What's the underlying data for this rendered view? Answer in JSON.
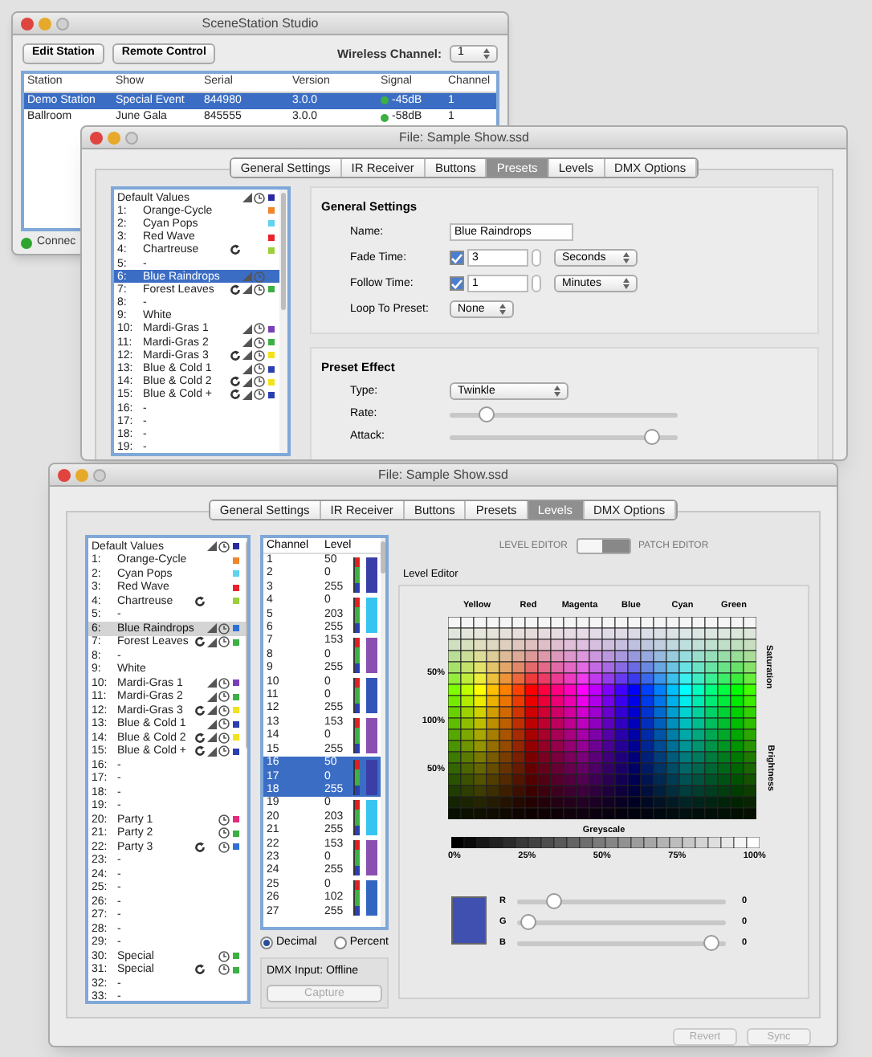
{
  "station_window": {
    "title": "SceneStation Studio",
    "buttons": [
      "Edit Station",
      "Remote Control"
    ],
    "wireless_channel": {
      "label": "Wireless Channel:",
      "value": "1"
    },
    "table": {
      "columns": [
        "Station",
        "Show",
        "Serial",
        "Version",
        "Signal",
        "Channel"
      ],
      "rows": [
        {
          "cells": [
            "Demo Station",
            "Special Event",
            "844980",
            "3.0.0",
            "-45dB",
            "1"
          ],
          "selected": true
        },
        {
          "cells": [
            "Ballroom",
            "June Gala",
            "845555",
            "3.0.0",
            "-58dB",
            "1"
          ],
          "selected": false
        }
      ]
    },
    "status": {
      "text": "Connec",
      "color": "#2fa52f"
    }
  },
  "presets_window": {
    "title": "File: Sample Show.ssd",
    "tabs": [
      {
        "label": "General Settings",
        "selected": false
      },
      {
        "label": "IR Receiver",
        "selected": false
      },
      {
        "label": "Buttons",
        "selected": false
      },
      {
        "label": "Presets",
        "selected": true
      },
      {
        "label": "Levels",
        "selected": false
      },
      {
        "label": "DMX Options",
        "selected": false
      }
    ],
    "presets": [
      {
        "name": "Default Values",
        "loop": false,
        "fade": true,
        "clock": true,
        "color": "#2a2aa0",
        "selected": false
      },
      {
        "number": "1:",
        "name": "Orange-Cycle",
        "loop": false,
        "fade": false,
        "clock": false,
        "color": "#f0852a",
        "selected": false
      },
      {
        "number": "2:",
        "name": "Cyan Pops",
        "loop": false,
        "fade": false,
        "clock": false,
        "color": "#5fd3ef",
        "selected": false
      },
      {
        "number": "3:",
        "name": "Red Wave",
        "loop": false,
        "fade": false,
        "clock": false,
        "color": "#e8242a",
        "selected": false
      },
      {
        "number": "4:",
        "name": "Chartreuse",
        "loop": true,
        "fade": false,
        "clock": false,
        "color": "#9ccf3a",
        "selected": false
      },
      {
        "number": "5:",
        "name": "-",
        "loop": false,
        "fade": false,
        "clock": false,
        "selected": false
      },
      {
        "number": "6:",
        "name": "Blue Raindrops",
        "loop": false,
        "fade": true,
        "clock": true,
        "selected": true
      },
      {
        "number": "7:",
        "name": "Forest Leaves",
        "loop": true,
        "fade": true,
        "clock": true,
        "color": "#3cb043",
        "selected": false
      },
      {
        "number": "8:",
        "name": "-",
        "loop": false,
        "fade": false,
        "clock": false,
        "selected": false
      },
      {
        "number": "9:",
        "name": "White",
        "loop": false,
        "fade": false,
        "clock": false,
        "selected": false
      },
      {
        "number": "10:",
        "name": "Mardi-Gras 1",
        "loop": false,
        "fade": true,
        "clock": true,
        "color": "#7a3fb8",
        "selected": false
      },
      {
        "number": "11:",
        "name": "Mardi-Gras 2",
        "loop": false,
        "fade": true,
        "clock": true,
        "color": "#3cb043",
        "selected": false
      },
      {
        "number": "12:",
        "name": "Mardi-Gras 3",
        "loop": true,
        "fade": true,
        "clock": true,
        "color": "#f2e21a",
        "selected": false
      },
      {
        "number": "13:",
        "name": "Blue & Cold 1",
        "loop": false,
        "fade": true,
        "clock": true,
        "color": "#2a3fb0",
        "selected": false
      },
      {
        "number": "14:",
        "name": "Blue & Cold 2",
        "loop": true,
        "fade": true,
        "clock": true,
        "color": "#f2e21a",
        "selected": false
      },
      {
        "number": "15:",
        "name": "Blue & Cold +",
        "loop": true,
        "fade": true,
        "clock": true,
        "color": "#2a3fb0",
        "selected": false
      },
      {
        "number": "16:",
        "name": "-",
        "loop": false,
        "fade": false,
        "clock": false,
        "selected": false
      },
      {
        "number": "17:",
        "name": "-",
        "loop": false,
        "fade": false,
        "clock": false,
        "selected": false
      },
      {
        "number": "18:",
        "name": "-",
        "loop": false,
        "fade": false,
        "clock": false,
        "selected": false
      },
      {
        "number": "19:",
        "name": "-",
        "loop": false,
        "fade": false,
        "clock": false,
        "selected": false
      }
    ],
    "general_settings": {
      "title": "General Settings",
      "name": {
        "label": "Name:",
        "value": "Blue Raindrops"
      },
      "times": [
        {
          "label": "Fade Time:",
          "checked": true,
          "value": "3",
          "unit": "Seconds"
        },
        {
          "label": "Follow Time:",
          "checked": true,
          "value": "1",
          "unit": "Minutes"
        }
      ],
      "loop_to_preset": {
        "label": "Loop To Preset:",
        "value": "None"
      }
    },
    "preset_effect": {
      "title": "Preset Effect",
      "type": {
        "label": "Type:",
        "value": "Twinkle"
      },
      "sliders": [
        {
          "label": "Rate:",
          "level": 0.14
        },
        {
          "label": "Attack:",
          "level": 0.92
        }
      ]
    }
  },
  "levels_window": {
    "title": "File: Sample Show.ssd",
    "tabs": [
      {
        "label": "General Settings",
        "selected": false
      },
      {
        "label": "IR Receiver",
        "selected": false
      },
      {
        "label": "Buttons",
        "selected": false
      },
      {
        "label": "Presets",
        "selected": false
      },
      {
        "label": "Levels",
        "selected": true
      },
      {
        "label": "DMX Options",
        "selected": false
      }
    ],
    "presets": [
      {
        "name": "Default Values",
        "loop": false,
        "fade": true,
        "clock": true,
        "color": "#2a2aa0",
        "selected": false
      },
      {
        "number": "1:",
        "name": "Orange-Cycle",
        "loop": false,
        "fade": false,
        "clock": false,
        "color": "#f0852a",
        "selected": false
      },
      {
        "number": "2:",
        "name": "Cyan Pops",
        "loop": false,
        "fade": false,
        "clock": false,
        "color": "#5fd3ef",
        "selected": false
      },
      {
        "number": "3:",
        "name": "Red Wave",
        "loop": false,
        "fade": false,
        "clock": false,
        "color": "#e8242a",
        "selected": false
      },
      {
        "number": "4:",
        "name": "Chartreuse",
        "loop": true,
        "fade": false,
        "clock": false,
        "color": "#9ccf3a",
        "selected": false
      },
      {
        "number": "5:",
        "name": "-",
        "loop": false,
        "fade": false,
        "clock": false,
        "selected": false
      },
      {
        "number": "6:",
        "name": "Blue Raindrops",
        "loop": false,
        "fade": true,
        "clock": true,
        "color": "#2f6fd8",
        "selected": true
      },
      {
        "number": "7:",
        "name": "Forest Leaves",
        "loop": true,
        "fade": true,
        "clock": true,
        "color": "#3cb043",
        "selected": false
      },
      {
        "number": "8:",
        "name": "-",
        "loop": false,
        "fade": false,
        "clock": false,
        "selected": false
      },
      {
        "number": "9:",
        "name": "White",
        "loop": false,
        "fade": false,
        "clock": false,
        "selected": false
      },
      {
        "number": "10:",
        "name": "Mardi-Gras 1",
        "loop": false,
        "fade": true,
        "clock": true,
        "color": "#7a3fb8",
        "selected": false
      },
      {
        "number": "11:",
        "name": "Mardi-Gras 2",
        "loop": false,
        "fade": true,
        "clock": true,
        "color": "#3cb043",
        "selected": false
      },
      {
        "number": "12:",
        "name": "Mardi-Gras 3",
        "loop": true,
        "fade": true,
        "clock": true,
        "color": "#f2e21a",
        "selected": false
      },
      {
        "number": "13:",
        "name": "Blue & Cold 1",
        "loop": false,
        "fade": true,
        "clock": true,
        "color": "#2a3fb0",
        "selected": false
      },
      {
        "number": "14:",
        "name": "Blue & Cold 2",
        "loop": true,
        "fade": true,
        "clock": true,
        "color": "#f2e21a",
        "selected": false
      },
      {
        "number": "15:",
        "name": "Blue & Cold +",
        "loop": true,
        "fade": true,
        "clock": true,
        "color": "#2a3fb0",
        "selected": false
      },
      {
        "number": "16:",
        "name": "-",
        "loop": false,
        "fade": false,
        "clock": false,
        "selected": false
      },
      {
        "number": "17:",
        "name": "-",
        "loop": false,
        "fade": false,
        "clock": false,
        "selected": false
      },
      {
        "number": "18:",
        "name": "-",
        "loop": false,
        "fade": false,
        "clock": false,
        "selected": false
      },
      {
        "number": "19:",
        "name": "-",
        "loop": false,
        "fade": false,
        "clock": false,
        "selected": false
      },
      {
        "number": "20:",
        "name": "Party 1",
        "loop": false,
        "fade": false,
        "clock": true,
        "color": "#e8287a",
        "selected": false
      },
      {
        "number": "21:",
        "name": "Party 2",
        "loop": false,
        "fade": false,
        "clock": true,
        "color": "#3cb043",
        "selected": false
      },
      {
        "number": "22:",
        "name": "Party 3",
        "loop": true,
        "fade": false,
        "clock": true,
        "color": "#2f6fd8",
        "selected": false
      },
      {
        "number": "23:",
        "name": "-",
        "loop": false,
        "fade": false,
        "clock": false,
        "selected": false
      },
      {
        "number": "24:",
        "name": "-",
        "loop": false,
        "fade": false,
        "clock": false,
        "selected": false
      },
      {
        "number": "25:",
        "name": "-",
        "loop": false,
        "fade": false,
        "clock": false,
        "selected": false
      },
      {
        "number": "26:",
        "name": "-",
        "loop": false,
        "fade": false,
        "clock": false,
        "selected": false
      },
      {
        "number": "27:",
        "name": "-",
        "loop": false,
        "fade": false,
        "clock": false,
        "selected": false
      },
      {
        "number": "28:",
        "name": "-",
        "loop": false,
        "fade": false,
        "clock": false,
        "selected": false
      },
      {
        "number": "29:",
        "name": "-",
        "loop": false,
        "fade": false,
        "clock": false,
        "selected": false
      },
      {
        "number": "30:",
        "name": "Special",
        "loop": false,
        "fade": false,
        "clock": true,
        "color": "#3cb043",
        "selected": false
      },
      {
        "number": "31:",
        "name": "Special",
        "loop": true,
        "fade": false,
        "clock": true,
        "color": "#3cb043",
        "selected": false
      },
      {
        "number": "32:",
        "name": "-",
        "loop": false,
        "fade": false,
        "clock": false,
        "selected": false
      },
      {
        "number": "33:",
        "name": "-",
        "loop": false,
        "fade": false,
        "clock": false,
        "selected": false
      }
    ],
    "channels": {
      "columns": [
        "Channel",
        "Level"
      ],
      "groups": [
        {
          "rows": [
            [
              "1",
              "50"
            ],
            [
              "2",
              "0"
            ],
            [
              "3",
              "255"
            ]
          ],
          "color": "#3a3fa8",
          "selected": false
        },
        {
          "rows": [
            [
              "4",
              "0"
            ],
            [
              "5",
              "203"
            ],
            [
              "6",
              "255"
            ]
          ],
          "color": "#38c4f0",
          "selected": false
        },
        {
          "rows": [
            [
              "7",
              "153"
            ],
            [
              "8",
              "0"
            ],
            [
              "9",
              "255"
            ]
          ],
          "color": "#8a4fb0",
          "selected": false
        },
        {
          "rows": [
            [
              "10",
              "0"
            ],
            [
              "11",
              "0"
            ],
            [
              "12",
              "255"
            ]
          ],
          "color": "#3355b8",
          "selected": false
        },
        {
          "rows": [
            [
              "13",
              "153"
            ],
            [
              "14",
              "0"
            ],
            [
              "15",
              "255"
            ]
          ],
          "color": "#8a4fb0",
          "selected": false
        },
        {
          "rows": [
            [
              "16",
              "50"
            ],
            [
              "17",
              "0"
            ],
            [
              "18",
              "255"
            ]
          ],
          "color": "#3a3fa8",
          "selected": true
        },
        {
          "rows": [
            [
              "19",
              "0"
            ],
            [
              "20",
              "203"
            ],
            [
              "21",
              "255"
            ]
          ],
          "color": "#38c4f0",
          "selected": false
        },
        {
          "rows": [
            [
              "22",
              "153"
            ],
            [
              "23",
              "0"
            ],
            [
              "24",
              "255"
            ]
          ],
          "color": "#8a4fb0",
          "selected": false
        },
        {
          "rows": [
            [
              "25",
              "0"
            ],
            [
              "26",
              "102"
            ],
            [
              "27",
              "255"
            ]
          ],
          "color": "#3366c0",
          "selected": false
        }
      ]
    },
    "format_options": [
      {
        "label": "Decimal",
        "selected": true
      },
      {
        "label": "Percent",
        "selected": false
      }
    ],
    "dmx_input": "DMX Input: Offline",
    "capture_button": {
      "label": "Capture",
      "disabled": true
    },
    "editor_toggle": {
      "left_label": "LEVEL EDITOR",
      "right_label": "PATCH EDITOR",
      "on": true
    },
    "level_editor": {
      "title": "Level Editor",
      "hue_labels": [
        "Yellow",
        "Red",
        "Magenta",
        "Blue",
        "Cyan",
        "Green"
      ],
      "left_labels": [
        "50%",
        "100%",
        "50%"
      ],
      "right_labels": [
        "Saturation",
        "Brightness"
      ],
      "greyscale_label": "Greyscale",
      "greyscale_ticks": [
        "0%",
        "25%",
        "50%",
        "75%",
        "100%"
      ],
      "sliders": [
        {
          "label": "R",
          "level": 0.15,
          "reading": "0"
        },
        {
          "label": "G",
          "level": 0.02,
          "reading": "0"
        },
        {
          "label": "B",
          "level": 0.97,
          "reading": "0"
        }
      ]
    },
    "footer_buttons": [
      {
        "label": "Revert",
        "disabled": true
      },
      {
        "label": "Sync",
        "disabled": true
      }
    ]
  }
}
